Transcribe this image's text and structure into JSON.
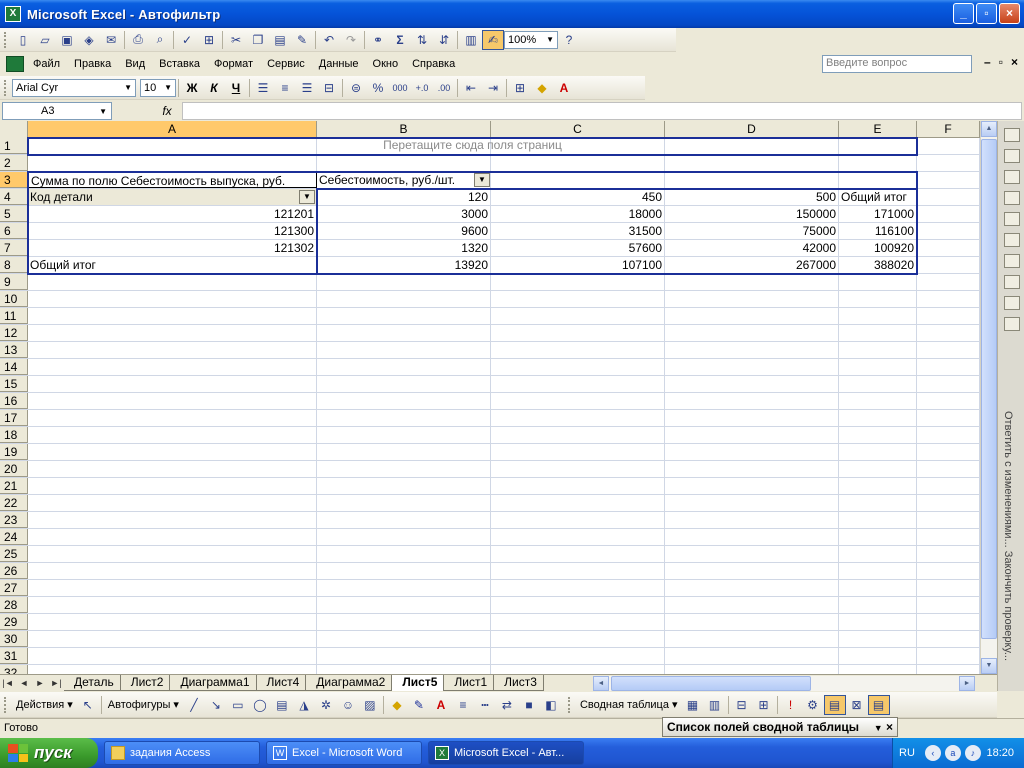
{
  "window": {
    "title": "Microsoft Excel - Автофильтр",
    "controls": {
      "minimize": "_",
      "maximize": "▫",
      "close": "×"
    }
  },
  "toolbar_standard": {
    "icons": [
      "new-icon",
      "open-icon",
      "save-icon",
      "permission-icon",
      "email-icon",
      "print-icon",
      "print-preview-icon",
      "spelling-icon",
      "research-icon",
      "cut-icon",
      "copy-icon",
      "paste-icon",
      "format-painter-icon",
      "undo-icon",
      "redo-icon",
      "hyperlink-icon",
      "autosum-icon",
      "sort-ascending-icon",
      "sort-descending-icon",
      "chart-wizard-icon",
      "drawing-icon",
      "help-icon"
    ],
    "zoom": "100%"
  },
  "menu": {
    "items": [
      "Файл",
      "Правка",
      "Вид",
      "Вставка",
      "Формат",
      "Сервис",
      "Данные",
      "Окно",
      "Справка"
    ],
    "help_placeholder": "Введите вопрос"
  },
  "toolbar_format": {
    "font": "Arial Cyr",
    "size": "10",
    "bold": "Ж",
    "italic": "К",
    "underline": "Ч",
    "percent": "%",
    "thousands": "000"
  },
  "formula_bar": {
    "name_box": "A3",
    "fx": "fx",
    "value": ""
  },
  "columns": [
    "A",
    "B",
    "C",
    "D",
    "E",
    "F"
  ],
  "rows": {
    "numbers": [
      "1",
      "2",
      "3",
      "4",
      "5",
      "6",
      "7",
      "8",
      "9",
      "10",
      "11",
      "12",
      "13",
      "14",
      "15",
      "16",
      "17",
      "18",
      "19",
      "20",
      "21",
      "22",
      "23",
      "24",
      "25",
      "26",
      "27",
      "28",
      "29",
      "30",
      "31",
      "32"
    ],
    "page_zone": "Перетащите сюда поля страниц",
    "r3": {
      "a": "Сумма по полю Себестоимость выпуска, руб.",
      "b": "Себестоимость, руб./шт."
    },
    "r4": {
      "a": "Код  детали",
      "b": "120",
      "c": "450",
      "d": "500",
      "e": "Общий итог"
    },
    "r5": {
      "a": "121201",
      "b": "3000",
      "c": "18000",
      "d": "150000",
      "e": "171000"
    },
    "r6": {
      "a": "121300",
      "b": "9600",
      "c": "31500",
      "d": "75000",
      "e": "116100"
    },
    "r7": {
      "a": "121302",
      "b": "1320",
      "c": "57600",
      "d": "42000",
      "e": "100920"
    },
    "r8": {
      "a": "Общий итог",
      "b": "13920",
      "c": "107100",
      "d": "267000",
      "e": "388020"
    }
  },
  "task_pane": {
    "text": "Ответить с изменениями...  Закончить проверку..."
  },
  "sheet_tabs": [
    "Деталь",
    "Лист2",
    "Диаграмма1",
    "Лист4",
    "Диаграмма2",
    "Лист5",
    "Лист1",
    "Лист3"
  ],
  "active_tab": "Лист5",
  "toolbar_bottom": {
    "actions": "Действия",
    "autoshapes": "Автофигуры",
    "pivot_table": "Сводная таблица"
  },
  "status": {
    "text": "Готово",
    "field_list": "Список полей сводной таблицы"
  },
  "taskbar": {
    "start": "пуск",
    "buttons": [
      "задания Access",
      "Excel - Microsoft Word",
      "Microsoft Excel - Авт..."
    ],
    "lang": "RU",
    "time": "18:20"
  }
}
